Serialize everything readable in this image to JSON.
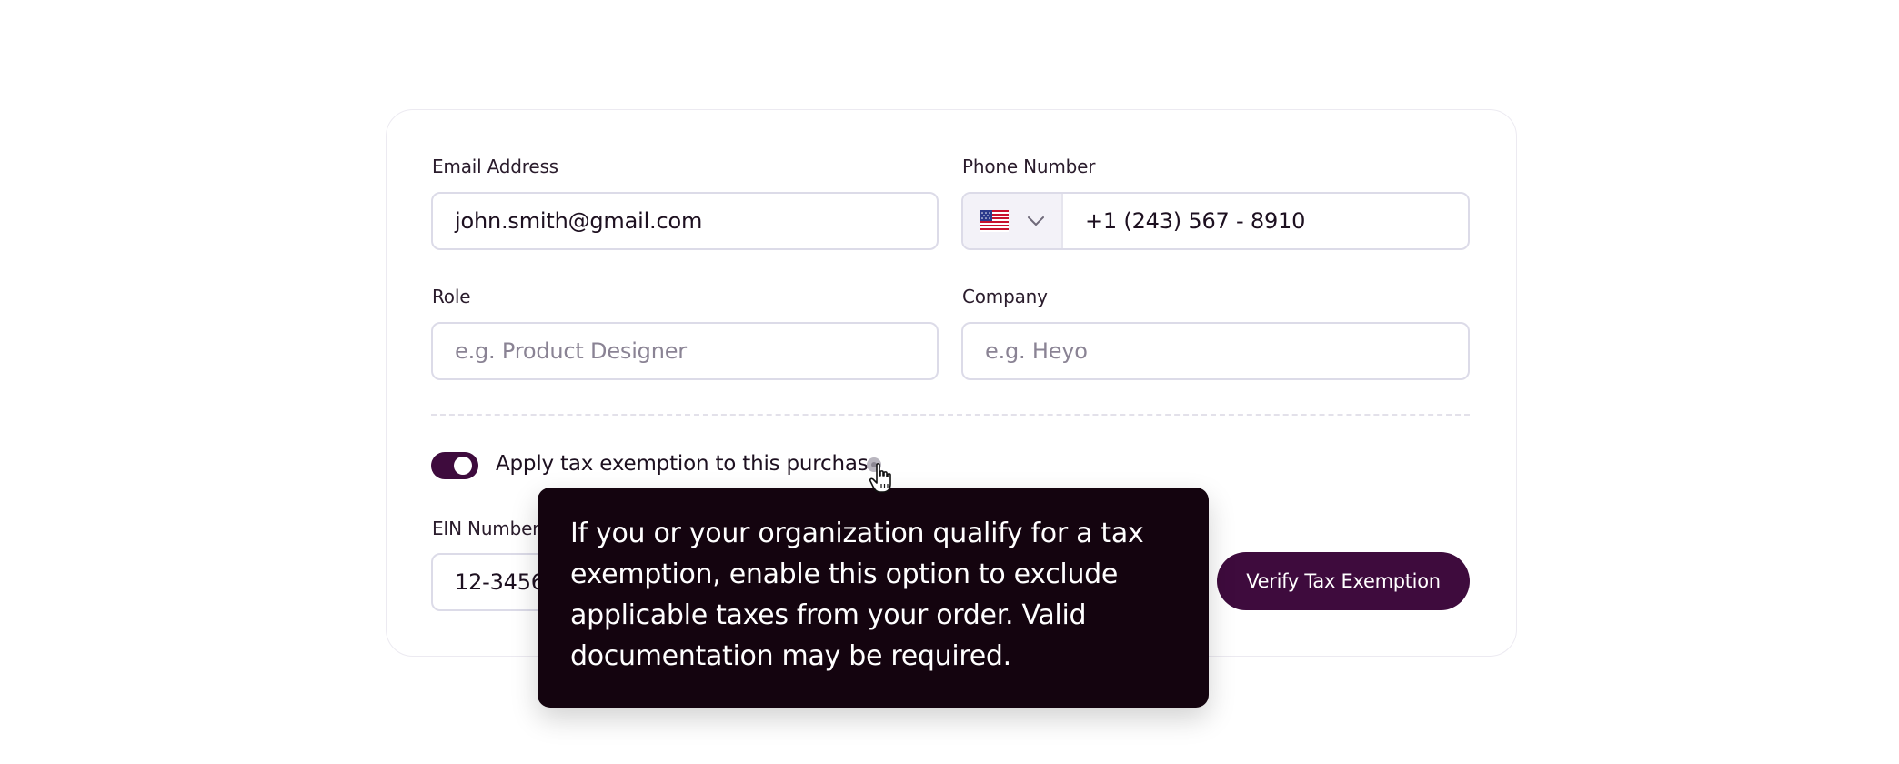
{
  "form": {
    "email": {
      "label": "Email Address",
      "value": "john.smith@gmail.com"
    },
    "phone": {
      "label": "Phone Number",
      "country": "United States",
      "value": "+1 (243) 567 - 8910"
    },
    "role": {
      "label": "Role",
      "value": "",
      "placeholder": "e.g. Product Designer"
    },
    "company": {
      "label": "Company",
      "value": "",
      "placeholder": "e.g. Heyo"
    },
    "tax": {
      "toggle_on": true,
      "toggle_label": "Apply tax exemption to this purchase",
      "ein_label": "EIN Number",
      "ein_value": "12-3456",
      "verify_label": "Verify Tax Exemption"
    }
  },
  "tooltip": {
    "text": "If you or your organization qualify for a tax exemption, enable this option to exclude applicable taxes from your order. Valid documentation may be required."
  },
  "icons": {
    "flag": "us-flag-icon",
    "chevron": "chevron-down-icon",
    "info": "info-icon",
    "cursor": "hand-pointer-cursor-icon"
  },
  "colors": {
    "accent": "#3e0b3d",
    "tooltip_bg": "#14040f",
    "field_border": "#dcdbe8",
    "country_bg": "#f3f2f8"
  }
}
